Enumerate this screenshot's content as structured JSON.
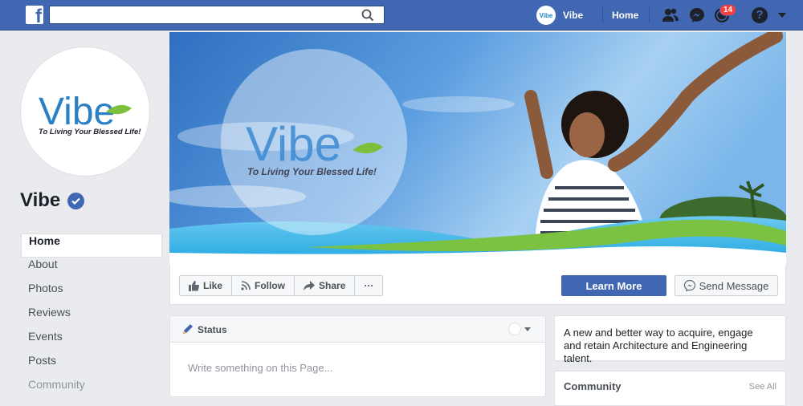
{
  "topbar": {
    "logo_letter": "f",
    "search_placeholder": "",
    "profile_name": "Vibe",
    "avatar_text": "Vibe",
    "home_label": "Home",
    "notification_count": "14",
    "help_glyph": "?",
    "colors": {
      "bar": "#4267b2",
      "badge": "#fa3e3e"
    },
    "icons": [
      "facebook-logo-icon",
      "search-icon",
      "friend-requests-icon",
      "messenger-icon",
      "notifications-icon",
      "help-icon",
      "account-menu-caret-icon"
    ]
  },
  "page": {
    "name": "Vibe",
    "verified_icon": "verified-check-icon",
    "logo": {
      "wordmark": "Vibe",
      "tagline": "To Living Your Blessed Life!"
    }
  },
  "nav": {
    "items": [
      {
        "label": "Home",
        "active": true
      },
      {
        "label": "About"
      },
      {
        "label": "Photos"
      },
      {
        "label": "Reviews"
      },
      {
        "label": "Events"
      },
      {
        "label": "Posts"
      },
      {
        "label": "Community",
        "muted": true
      }
    ]
  },
  "actions": {
    "like": "Like",
    "follow": "Follow",
    "share": "Share",
    "more": "···",
    "learn_more": "Learn More",
    "send_message": "Send Message"
  },
  "composer": {
    "tab": "Status",
    "placeholder": "Write something on this Page..."
  },
  "about": {
    "line1": "A new and better way to acquire, engage",
    "line2": "and retain Architecture and Engineering talent."
  },
  "community": {
    "title": "Community",
    "see_all": "See All"
  }
}
